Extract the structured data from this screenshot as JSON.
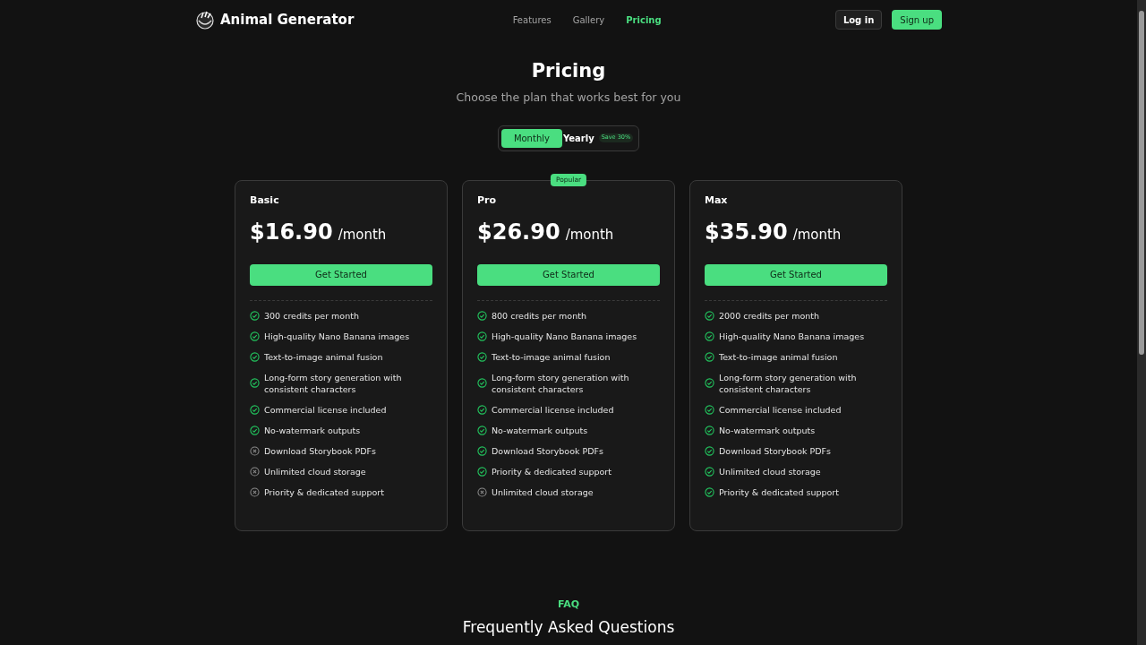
{
  "header": {
    "brand": "Animal Generator",
    "nav": [
      {
        "label": "Features",
        "selected": false
      },
      {
        "label": "Gallery",
        "selected": false
      },
      {
        "label": "Pricing",
        "selected": true
      }
    ],
    "login": "Log in",
    "signup": "Sign up"
  },
  "hero": {
    "title": "Pricing",
    "subtitle": "Choose the plan that works best for you"
  },
  "billing_toggle": {
    "options": [
      {
        "label": "Monthly",
        "selected": true
      },
      {
        "label": "Yearly",
        "selected": false
      }
    ],
    "badge": "Save 30%"
  },
  "plans": [
    {
      "name": "Basic",
      "price": "$16.90",
      "period": "/month",
      "cta": "Get Started",
      "features": [
        {
          "text": "300 credits per month",
          "included": true
        },
        {
          "text": "High-quality Nano Banana images",
          "included": true
        },
        {
          "text": "Text-to-image animal fusion",
          "included": true
        },
        {
          "text": "Long-form story generation with consistent characters",
          "included": true
        },
        {
          "text": "Commercial license included",
          "included": true
        },
        {
          "text": "No-watermark outputs",
          "included": true
        },
        {
          "text": "Download Storybook PDFs",
          "included": false
        },
        {
          "text": "Unlimited cloud storage",
          "included": false
        },
        {
          "text": "Priority & dedicated support",
          "included": false
        }
      ]
    },
    {
      "name": "Pro",
      "badge": "Popular",
      "price": "$26.90",
      "period": "/month",
      "cta": "Get Started",
      "features": [
        {
          "text": "800 credits per month",
          "included": true
        },
        {
          "text": "High-quality Nano Banana images",
          "included": true
        },
        {
          "text": "Text-to-image animal fusion",
          "included": true
        },
        {
          "text": "Long-form story generation with consistent characters",
          "included": true
        },
        {
          "text": "Commercial license included",
          "included": true
        },
        {
          "text": "No-watermark outputs",
          "included": true
        },
        {
          "text": "Download Storybook PDFs",
          "included": true
        },
        {
          "text": "Priority & dedicated support",
          "included": true
        },
        {
          "text": "Unlimited cloud storage",
          "included": false
        }
      ]
    },
    {
      "name": "Max",
      "price": "$35.90",
      "period": "/month",
      "cta": "Get Started",
      "features": [
        {
          "text": "2000 credits per month",
          "included": true
        },
        {
          "text": "High-quality Nano Banana images",
          "included": true
        },
        {
          "text": "Text-to-image animal fusion",
          "included": true
        },
        {
          "text": "Long-form story generation with consistent characters",
          "included": true
        },
        {
          "text": "Commercial license included",
          "included": true
        },
        {
          "text": "No-watermark outputs",
          "included": true
        },
        {
          "text": "Download Storybook PDFs",
          "included": true
        },
        {
          "text": "Unlimited cloud storage",
          "included": true
        },
        {
          "text": "Priority & dedicated support",
          "included": true
        }
      ]
    }
  ],
  "faq": {
    "eyebrow": "FAQ",
    "title": "Frequently Asked Questions"
  }
}
